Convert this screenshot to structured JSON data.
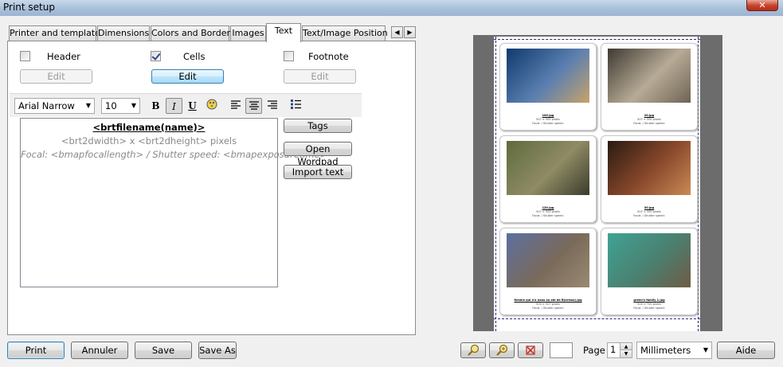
{
  "window": {
    "title": "Print setup",
    "close_label": "✕"
  },
  "tabs": [
    {
      "label": "Printer and templates"
    },
    {
      "label": "Dimensions"
    },
    {
      "label": "Colors and Borders"
    },
    {
      "label": "Images"
    },
    {
      "label": "Text"
    },
    {
      "label": "Text/Image Position"
    }
  ],
  "tab_scroll": {
    "left": "◀",
    "right": "▶"
  },
  "sections": {
    "header": {
      "label": "Header",
      "checked": false,
      "edit_label": "Edit"
    },
    "cells": {
      "label": "Cells",
      "checked": true,
      "edit_label": "Edit"
    },
    "footnote": {
      "label": "Footnote",
      "checked": false,
      "edit_label": "Edit"
    }
  },
  "format": {
    "font": "Arial Narrow",
    "size": "10",
    "bold": "B",
    "italic": "I",
    "underline": "U"
  },
  "editor": {
    "line1": "<brtfilename(name)>",
    "line2": "<brt2dwidth> x <brt2dheight> pixels",
    "line3": "Focal: <bmapfocallength> / Shutter speed: <bmapexposuretime>"
  },
  "side_buttons": {
    "tags": "Tags",
    "wordpad": "Open Wordpad",
    "import": "Import text"
  },
  "bottom": {
    "print": "Print",
    "cancel": "Annuler",
    "save": "Save",
    "save_as": "Save As",
    "page_label": "Page",
    "page_value": "1",
    "units": "Millimeters",
    "help": "Aide"
  },
  "preview_cells": [
    {
      "name": "100.jpg",
      "dims": "507 × 500 pixels",
      "meta": "Focal: / Shutter speed:",
      "colors": [
        "#0f3a6e",
        "#5b7fb0",
        "#c7a36a"
      ]
    },
    {
      "name": "20.jpg",
      "dims": "507 × 500 pixels",
      "meta": "Focal: / Shutter speed:",
      "colors": [
        "#3f3a33",
        "#b7ab96",
        "#6e6254"
      ]
    },
    {
      "name": "120.jpg",
      "dims": "507 × 500 pixels",
      "meta": "Focal: / Shutter speed:",
      "colors": [
        "#5f6b3d",
        "#8f8b64",
        "#3b3b2c"
      ]
    },
    {
      "name": "30.jpg",
      "dims": "507 × 500 pixels",
      "meta": "Focal: / Shutter speed:",
      "colors": [
        "#2a1a12",
        "#8b4a2c",
        "#c98a55"
      ]
    },
    {
      "name": "femme qui n'a nous ou ste de B(ormoz).jpg",
      "dims": "500 × 507 pixels",
      "meta": "Focal: / Shutter speed:",
      "colors": [
        "#5c6fa0",
        "#7a6a5a",
        "#9a8a72"
      ]
    },
    {
      "name": "green's family 1.jpg",
      "dims": "500 × 700 pixels",
      "meta": "Focal: / Shutter speed:",
      "colors": [
        "#3fa394",
        "#4b7f6f",
        "#6f5b45"
      ]
    }
  ]
}
